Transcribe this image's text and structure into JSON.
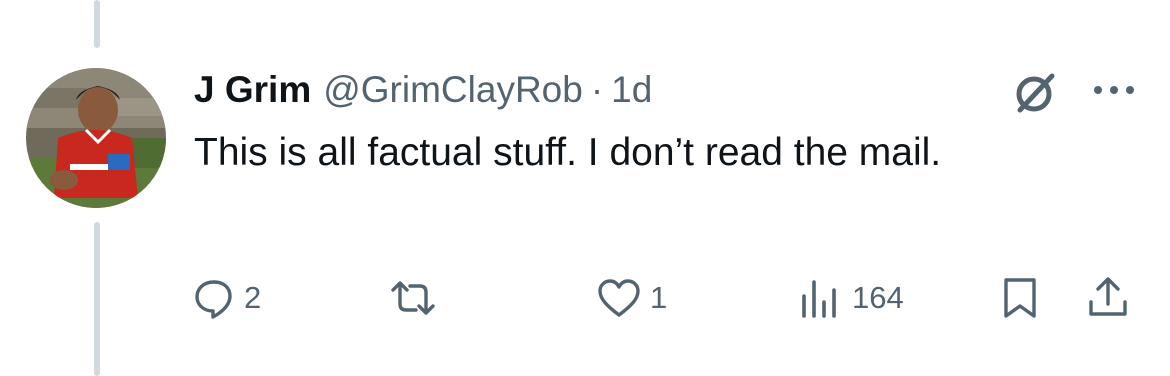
{
  "tweet": {
    "display_name": "J Grim",
    "handle": "@GrimClayRob",
    "separator": "·",
    "time": "1d",
    "text": "This is all factual stuff. I don’t read the mail."
  },
  "actions": {
    "reply_count": "2",
    "retweet_count": "",
    "like_count": "1",
    "view_count": "164"
  },
  "icons": {
    "reply": "speech-bubble-icon",
    "retweet": "retweet-arrows-icon",
    "like": "heart-icon",
    "views": "bar-chart-icon",
    "bookmark": "bookmark-icon",
    "share": "share-upload-icon",
    "grok": "grok-slash-circle-icon",
    "more": "more-dots-icon"
  },
  "colors": {
    "text_primary": "#0f1419",
    "text_secondary": "#536471",
    "thread_line": "#cfd9de"
  }
}
